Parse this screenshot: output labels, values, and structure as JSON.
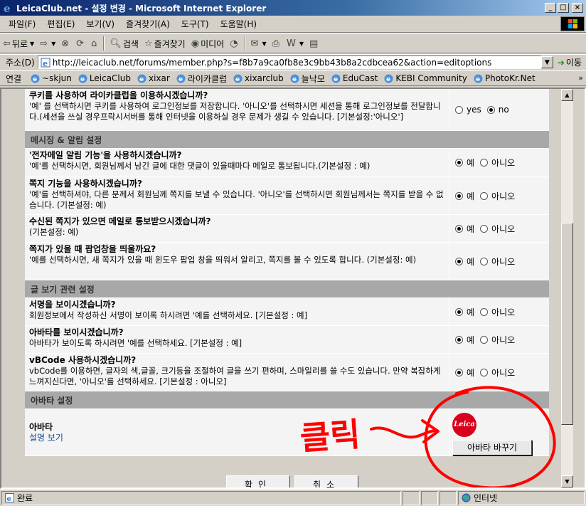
{
  "window": {
    "title": "LeicaClub.net - 설정 변경 - Microsoft Internet Explorer",
    "minimize": "_",
    "maximize": "□",
    "close": "×"
  },
  "menu": [
    "파일(F)",
    "편집(E)",
    "보기(V)",
    "즐겨찾기(A)",
    "도구(T)",
    "도움말(H)"
  ],
  "toolbar": {
    "back": "뒤로",
    "search": "검색",
    "favorites": "즐겨찾기",
    "media": "미디어"
  },
  "address": {
    "label": "주소(D)",
    "url": "http://leicaclub.net/forums/member.php?s=f8b7a9ca0fb8e3c9bb43b8a2cdbcea62&action=editoptions",
    "go": "이동"
  },
  "links": {
    "label": "연결",
    "items": [
      "~skjun",
      "LeicaClub",
      "xixar",
      "라이카클럽",
      "xixarclub",
      "늘낙모",
      "EduCast",
      "KEBI Community",
      "PhotoKr.Net"
    ],
    "more": "»"
  },
  "form": {
    "cookie": {
      "question": "쿠키를 사용하여 라이카클럽을 이용하시겠습니까?",
      "desc": "'예' 를 선택하시면 쿠키를 사용하여 로그인정보를 저장합니다. '아니오'를 선택하시면 세션을 통해 로그인정보를 전달합니다.(세션을 쓰실 경우프락시서버를 통해 인터넷을 이용하실 경우 문제가 생길 수 있습니다. [기본설정:'아니오']",
      "opt_yes": "yes",
      "opt_no": "no",
      "selected": "no"
    },
    "sections": {
      "messaging": "메시징 & 알림 설정",
      "reading": "글 보기 관련 설정",
      "avatar": "아바타 설정"
    },
    "options": [
      {
        "question": "'전자메일 알림 기능'을 사용하시겠습니까?",
        "desc": "'예'를 선택하시면, 회원님께서 남긴 글에 대한 댓글이 있을때마다 메일로 통보됩니다.(기본설정 : 예)",
        "yes": "예",
        "no": "아니오",
        "selected": "yes"
      },
      {
        "question": "쪽지 기능을 사용하시겠습니까?",
        "desc": "'예'를 선택하셔야, 다른 분께서 회원님께 쪽지를 보낼 수 있습니다. '아니오'를 선택하시면 회원님께서는 쪽지를 받을 수 없습니다. (기본설정: 예)",
        "yes": "예",
        "no": "아니오",
        "selected": "yes"
      },
      {
        "question": "수신된 쪽지가 있으면 메일로 통보받으시겠습니까?",
        "desc": "(기본설정: 예)",
        "yes": "예",
        "no": "아니오",
        "selected": "yes"
      },
      {
        "question": "쪽지가 있을 때 팝업창을 띄울까요?",
        "desc": "'예를 선택하시면, 새 쪽지가 있을 때 윈도우 팝업 창을 띄워서 알리고, 쪽지를 볼 수 있도록 합니다. (기본설정: 예)",
        "yes": "예",
        "no": "아니오",
        "selected": "yes"
      }
    ],
    "reading_options": [
      {
        "question": "서명을 보이시겠습니까?",
        "desc": "회원정보에서 작성하신 서명이 보이록 하시려면 '예를 선택하세요. [기본설정 : 예]",
        "yes": "예",
        "no": "아니오",
        "selected": "yes"
      },
      {
        "question": "아바타를 보이시겠습니까?",
        "desc": "아바타가 보이도록 하시려면 '예를 선택하세요. [기본설정 : 예]",
        "yes": "예",
        "no": "아니오",
        "selected": "yes"
      },
      {
        "question": "vBCode 사용하시겠습니까?",
        "desc": "vbCode를 이용하면, 글자의 색,글꼴, 크기등을 조절하여 글을 쓰기 편하며, 스마일리를 쓸 수도 있습니다. 만약 복잡하게 느껴지신다면, '아니오'를 선택하세요. [기본설정 : 아니오]",
        "yes": "예",
        "no": "아니오",
        "selected": "yes"
      }
    ],
    "avatar": {
      "label": "아바타",
      "help": "설명 보기",
      "logo_text": "Leica",
      "change_button": "아바타 바꾸기"
    },
    "submit": "확인",
    "cancel": "취소"
  },
  "annotation": {
    "text": "클릭",
    "color": "#ff0000"
  },
  "status": {
    "text": "완료",
    "zone": "인터넷"
  }
}
